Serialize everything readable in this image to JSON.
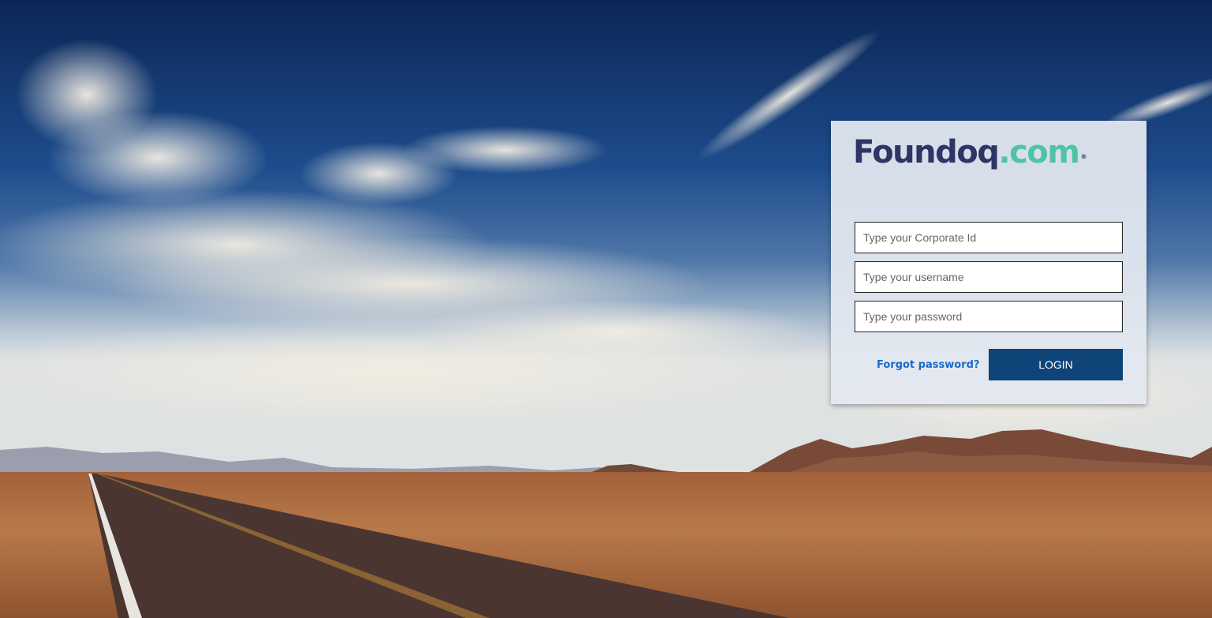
{
  "logo": {
    "brand": "Foundoq",
    "tld": ".com",
    "registered_mark": "®"
  },
  "form": {
    "corporate_id": {
      "placeholder": "Type your Corporate Id",
      "value": ""
    },
    "username": {
      "placeholder": "Type your username",
      "value": ""
    },
    "password": {
      "placeholder": "Type your password",
      "value": ""
    },
    "forgot_label": "Forgot password?",
    "login_label": "LOGIN"
  },
  "colors": {
    "brand_navy": "#2c3566",
    "brand_teal": "#4ec3a6",
    "button": "#0f4478",
    "link": "#1a6ac8"
  }
}
